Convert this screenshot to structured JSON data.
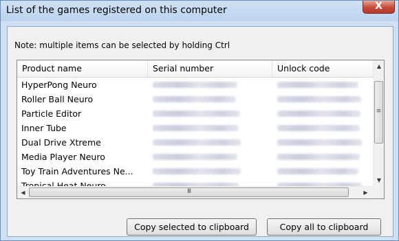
{
  "window": {
    "title": "List of the games registered on this computer",
    "close_glyph": "X"
  },
  "note": "Note: multiple items can be selected by holding Ctrl",
  "table": {
    "columns": [
      "Product name",
      "Serial number",
      "Unlock code"
    ],
    "rows": [
      {
        "product": "HyperPong Neuro"
      },
      {
        "product": "Roller Ball Neuro"
      },
      {
        "product": "Particle Editor"
      },
      {
        "product": "Inner Tube"
      },
      {
        "product": "Dual Drive Xtreme"
      },
      {
        "product": "Media Player Neuro"
      },
      {
        "product": "Toy Train Adventures Ne..."
      },
      {
        "product": "Tropical Heat Neuro"
      }
    ]
  },
  "scrollbar": {
    "up_icon": "▲",
    "down_icon": "▼",
    "left_icon": "◀",
    "right_icon": "▶",
    "grip": "≡",
    "hgrip": "III"
  },
  "buttons": {
    "copy_selected": "Copy selected to clipboard",
    "copy_all": "Copy all to clipboard"
  }
}
